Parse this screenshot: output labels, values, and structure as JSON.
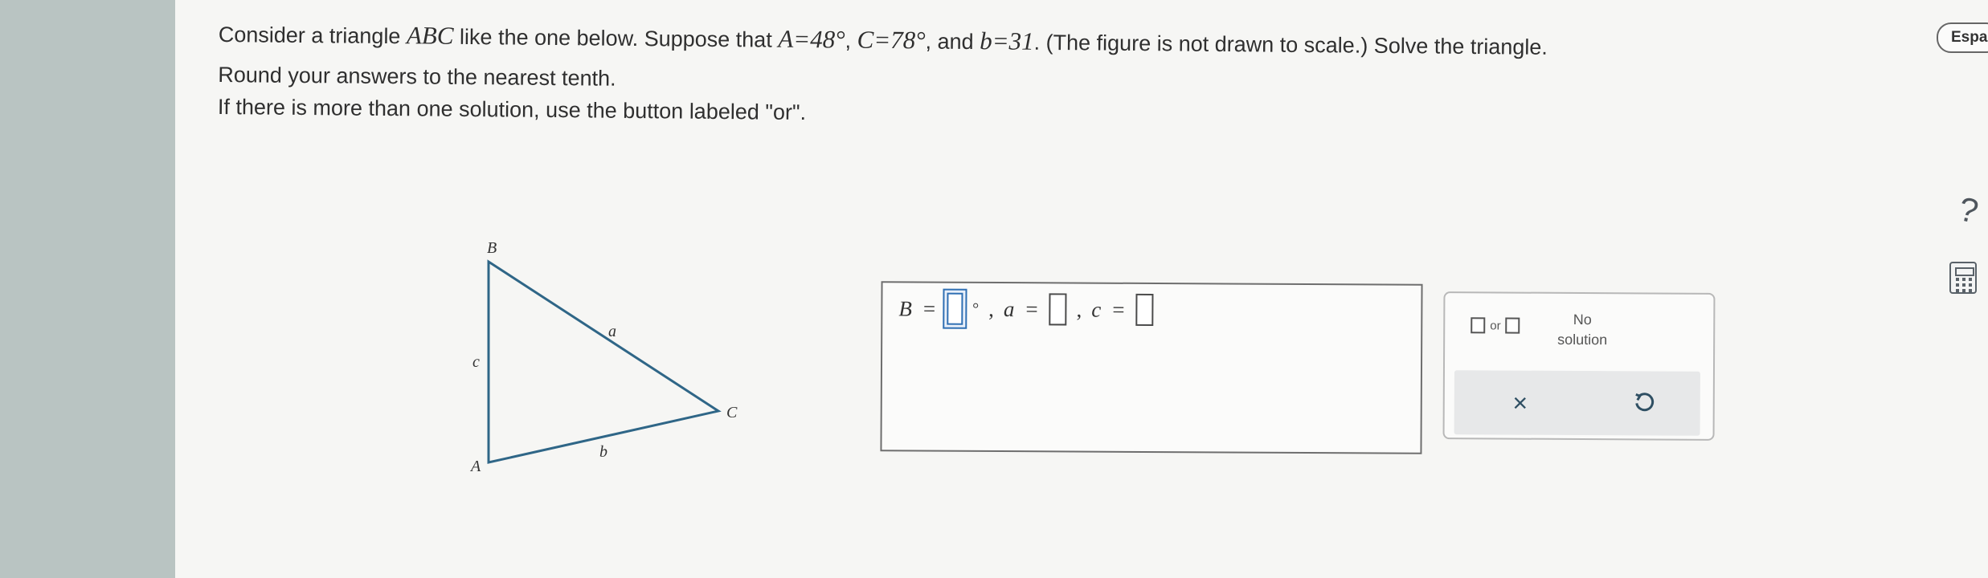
{
  "prompt": {
    "intro": "Consider a triangle",
    "triangle_name": "ABC",
    "like_text": "like the one below. Suppose that",
    "angle_A_label": "A",
    "angle_A_value": "48°",
    "angle_C_label": "C",
    "angle_C_value": "78°",
    "and_text": "and",
    "side_b_label": "b",
    "side_b_value": "31",
    "remainder": ". (The figure is not drawn to scale.) Solve the triangle.",
    "round_instruction": "Round your answers to the nearest tenth.",
    "multiple_solution_instruction": "If there is more than one solution, use the button labeled \"or\"."
  },
  "figure": {
    "vertex_B": "B",
    "vertex_C": "C",
    "vertex_A": "A",
    "side_a": "a",
    "side_b": "b",
    "side_c": "c",
    "stroke_color": "#2f6687"
  },
  "answer": {
    "label_B": "B",
    "label_a": "a",
    "label_c": "c",
    "equals": "=",
    "degree_symbol": "°",
    "comma": ","
  },
  "tools": {
    "or_label": "or",
    "no_solution_line1": "No",
    "no_solution_line2": "solution",
    "clear_icon": "close-icon",
    "undo_icon": "undo-icon"
  },
  "side_panel": {
    "language_tab_label": "Espa",
    "help_icon": "question-mark-icon",
    "calculator_icon": "calculator-icon"
  },
  "colors": {
    "figure_line": "#2f6687",
    "active_input": "#2f6fb3",
    "background": "#f6f6f4"
  }
}
